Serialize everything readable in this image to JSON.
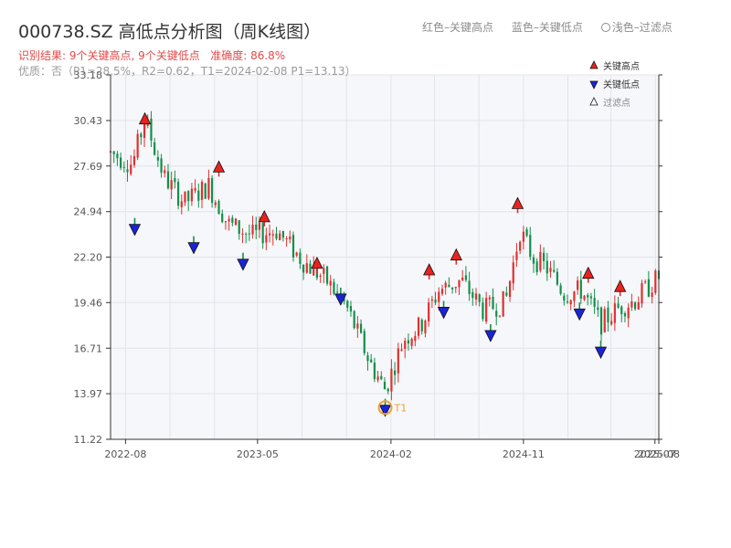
{
  "header": {
    "title": "000738.SZ 高低点分析图（周K线图）",
    "result_text": "识别结果: 9个关键高点, 9个关键低点",
    "accuracy_text": "准确度: 86.8%",
    "quality_text": "优质：否（P1=28.5%，R2=0.62，T1=2024-02-08 P1=13.13）",
    "legend_text": [
      "红色–关键高点",
      "蓝色–关键低点",
      "浅色–过滤点"
    ]
  },
  "colors": {
    "up": "#e03030",
    "down": "#12904a",
    "high_marker": "#e8231f",
    "low_marker": "#1a24d6",
    "t1_circle": "#f0a030",
    "plot_bg": "#f6f7fa",
    "grid": "#e1e4ea"
  },
  "chart_data": {
    "type": "candlestick",
    "title": "000738.SZ 高低点分析图（周K线图）",
    "y_ticks": [
      "11.22",
      "13.97",
      "16.71",
      "19.46",
      "22.20",
      "24.94",
      "27.69",
      "30.43",
      "33.18"
    ],
    "ylim": [
      11.22,
      33.18
    ],
    "x_ticks": [
      "2022-08",
      "2023-05",
      "2024-02",
      "2024-11",
      "2025-07",
      "2025-08"
    ],
    "xlim": [
      "2022-07-01",
      "2025-08-08"
    ],
    "grid": true,
    "legend_position": "top-right",
    "legend": [
      {
        "label": "关键高点",
        "marker": "triangle-up",
        "color": "#e8231f"
      },
      {
        "label": "关键低点",
        "marker": "triangle-down",
        "color": "#1a24d6"
      },
      {
        "label": "过滤点",
        "marker": "triangle-up-hollow",
        "color": "#ffffff"
      }
    ],
    "trend_points": [
      {
        "date": "2022-07-01",
        "price": 28.5
      },
      {
        "date": "2022-08-15",
        "price": 27.8
      },
      {
        "date": "2022-09-10",
        "price": 30.5
      },
      {
        "date": "2022-10-20",
        "price": 27.0
      },
      {
        "date": "2022-12-01",
        "price": 25.5
      },
      {
        "date": "2023-01-20",
        "price": 26.5
      },
      {
        "date": "2023-03-01",
        "price": 24.2
      },
      {
        "date": "2023-04-20",
        "price": 23.5
      },
      {
        "date": "2023-06-10",
        "price": 23.8
      },
      {
        "date": "2023-08-01",
        "price": 22.0
      },
      {
        "date": "2023-09-20",
        "price": 20.8
      },
      {
        "date": "2023-11-01",
        "price": 19.2
      },
      {
        "date": "2023-12-20",
        "price": 15.8
      },
      {
        "date": "2024-01-20",
        "price": 14.2
      },
      {
        "date": "2024-02-28",
        "price": 17.3
      },
      {
        "date": "2024-04-01",
        "price": 18.0
      },
      {
        "date": "2024-05-10",
        "price": 20.2
      },
      {
        "date": "2024-06-25",
        "price": 20.8
      },
      {
        "date": "2024-08-10",
        "price": 19.0
      },
      {
        "date": "2024-09-25",
        "price": 19.5
      },
      {
        "date": "2024-10-25",
        "price": 23.8
      },
      {
        "date": "2024-11-20",
        "price": 22.2
      },
      {
        "date": "2024-12-20",
        "price": 21.5
      },
      {
        "date": "2025-01-25",
        "price": 20.0
      },
      {
        "date": "2025-03-01",
        "price": 20.2
      },
      {
        "date": "2025-04-10",
        "price": 18.2
      },
      {
        "date": "2025-05-20",
        "price": 19.2
      },
      {
        "date": "2025-06-20",
        "price": 19.6
      },
      {
        "date": "2025-08-08",
        "price": 21.0
      }
    ],
    "key_highs": [
      {
        "date": "2022-09-10",
        "price": 30.5
      },
      {
        "date": "2023-02-10",
        "price": 27.6
      },
      {
        "date": "2023-05-15",
        "price": 24.6
      },
      {
        "date": "2023-09-01",
        "price": 21.8
      },
      {
        "date": "2024-04-20",
        "price": 21.4
      },
      {
        "date": "2024-06-15",
        "price": 22.3
      },
      {
        "date": "2024-10-20",
        "price": 25.4
      },
      {
        "date": "2025-03-15",
        "price": 21.2
      },
      {
        "date": "2025-05-20",
        "price": 20.4
      }
    ],
    "key_lows": [
      {
        "date": "2022-08-20",
        "price": 23.9
      },
      {
        "date": "2022-12-20",
        "price": 22.8
      },
      {
        "date": "2023-04-01",
        "price": 21.8
      },
      {
        "date": "2023-10-20",
        "price": 19.7
      },
      {
        "date": "2024-01-20",
        "price": 13.0
      },
      {
        "date": "2024-05-20",
        "price": 18.9
      },
      {
        "date": "2024-08-25",
        "price": 17.5
      },
      {
        "date": "2025-02-25",
        "price": 18.8
      },
      {
        "date": "2025-04-10",
        "price": 16.5
      }
    ],
    "t1": {
      "label": "T1",
      "date": "2024-01-20",
      "price": 13.13
    }
  }
}
